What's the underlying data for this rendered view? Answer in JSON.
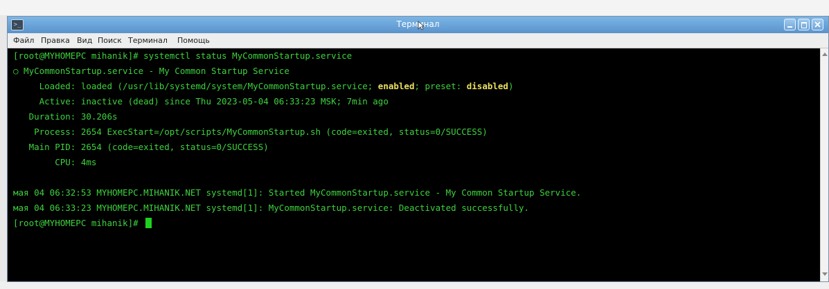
{
  "window": {
    "title": "Терминал",
    "app_icon": "terminal-icon",
    "titlebar_color": "#5a93cc"
  },
  "menubar": {
    "items": [
      "Файл",
      "Правка",
      "Вид",
      "Поиск",
      "Терминал",
      "Помощь"
    ]
  },
  "terminal": {
    "prompt_color": "#3dd23d",
    "highlight_color": "#e8e060",
    "lines": {
      "l1": "[root@MYHOMEPC mihanik]# systemctl status MyCommonStartup.service",
      "l2": "○ MyCommonStartup.service - My Common Startup Service",
      "l3a": "     Loaded: loaded (/usr/lib/systemd/system/MyCommonStartup.service; ",
      "l3b": "enabled",
      "l3c": "; preset: ",
      "l3d": "disabled",
      "l3e": ")",
      "l4": "     Active: inactive (dead) since Thu 2023-05-04 06:33:23 MSK; 7min ago",
      "l5": "   Duration: 30.206s",
      "l6": "    Process: 2654 ExecStart=/opt/scripts/MyCommonStartup.sh (code=exited, status=0/SUCCESS)",
      "l7": "   Main PID: 2654 (code=exited, status=0/SUCCESS)",
      "l8": "        CPU: 4ms",
      "l9": "мая 04 06:32:53 MYHOMEPC.MIHANIK.NET systemd[1]: Started MyCommonStartup.service - My Common Startup Service.",
      "l10": "мая 04 06:33:23 MYHOMEPC.MIHANIK.NET systemd[1]: MyCommonStartup.service: Deactivated successfully.",
      "l11": "[root@MYHOMEPC mihanik]# "
    }
  }
}
